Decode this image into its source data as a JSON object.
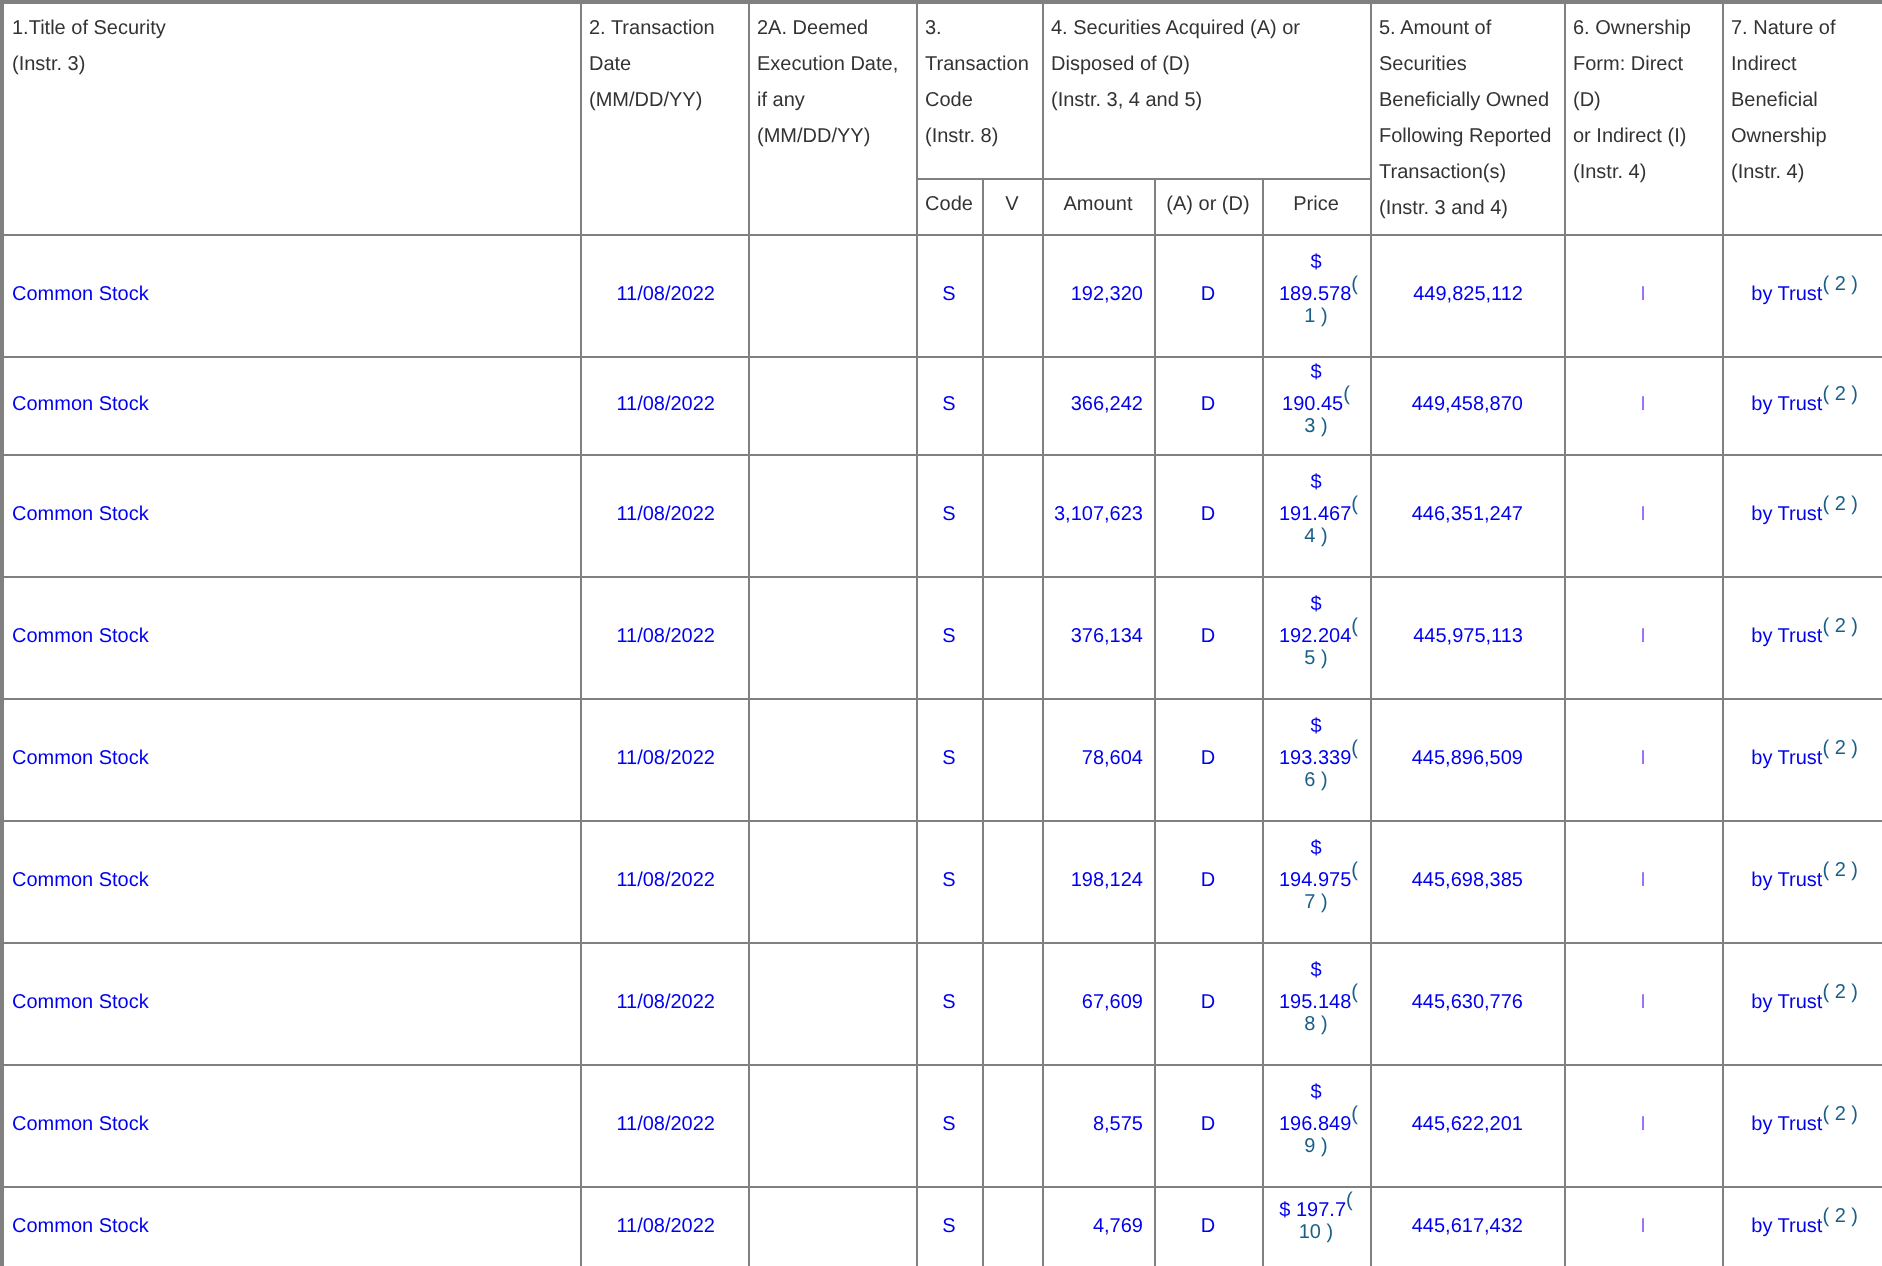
{
  "header": {
    "title_of_security": [
      "1.Title of Security",
      "(Instr. 3)"
    ],
    "transaction_date": [
      "2. Transaction",
      "Date",
      "(MM/DD/YY)"
    ],
    "deemed_execution_date": [
      "2A. Deemed",
      "Execution Date,",
      "if any",
      "(MM/DD/YY)"
    ],
    "transaction_code": [
      "3.",
      "Transaction",
      "Code",
      "(Instr. 8)"
    ],
    "securities_acquired_disposed": [
      "4. Securities Acquired (A) or",
      "Disposed of (D)",
      "(Instr. 3, 4 and 5)"
    ],
    "amount_owned": [
      "5. Amount of",
      "Securities",
      "Beneficially Owned",
      "Following Reported",
      "Transaction(s)",
      "(Instr. 3 and 4)"
    ],
    "ownership_form": [
      "6. Ownership",
      "Form: Direct (D)",
      "or Indirect (I)",
      "(Instr. 4)"
    ],
    "nature_of_ownership": [
      "7. Nature of",
      "Indirect",
      "Beneficial",
      "Ownership",
      "(Instr. 4)"
    ],
    "subheaders": [
      "Code",
      "V",
      "Amount",
      "(A) or (D)",
      "Price"
    ]
  },
  "rows": [
    {
      "title": "Common Stock",
      "date": "11/08/2022",
      "code": "S",
      "amount": "192,320",
      "a_or_d": "D",
      "price": "$ 189.578",
      "price_note": "( 1 )",
      "owned": "449,825,112",
      "form": "I",
      "nature": "by Trust",
      "nature_note": "( 2 )"
    },
    {
      "title": "Common Stock",
      "date": "11/08/2022",
      "code": "S",
      "amount": "366,242",
      "a_or_d": "D",
      "price": "$ 190.45",
      "price_note": "( 3 )",
      "owned": "449,458,870",
      "form": "I",
      "nature": "by Trust",
      "nature_note": "( 2 )"
    },
    {
      "title": "Common Stock",
      "date": "11/08/2022",
      "code": "S",
      "amount": "3,107,623",
      "a_or_d": "D",
      "price": "$ 191.467",
      "price_note": "( 4 )",
      "owned": "446,351,247",
      "form": "I",
      "nature": "by Trust",
      "nature_note": "( 2 )"
    },
    {
      "title": "Common Stock",
      "date": "11/08/2022",
      "code": "S",
      "amount": "376,134",
      "a_or_d": "D",
      "price": "$ 192.204",
      "price_note": "( 5 )",
      "owned": "445,975,113",
      "form": "I",
      "nature": "by Trust",
      "nature_note": "( 2 )"
    },
    {
      "title": "Common Stock",
      "date": "11/08/2022",
      "code": "S",
      "amount": "78,604",
      "a_or_d": "D",
      "price": "$ 193.339",
      "price_note": "( 6 )",
      "owned": "445,896,509",
      "form": "I",
      "nature": "by Trust",
      "nature_note": "( 2 )"
    },
    {
      "title": "Common Stock",
      "date": "11/08/2022",
      "code": "S",
      "amount": "198,124",
      "a_or_d": "D",
      "price": "$ 194.975",
      "price_note": "( 7 )",
      "owned": "445,698,385",
      "form": "I",
      "nature": "by Trust",
      "nature_note": "( 2 )"
    },
    {
      "title": "Common Stock",
      "date": "11/08/2022",
      "code": "S",
      "amount": "67,609",
      "a_or_d": "D",
      "price": "$ 195.148",
      "price_note": "( 8 )",
      "owned": "445,630,776",
      "form": "I",
      "nature": "by Trust",
      "nature_note": "( 2 )"
    },
    {
      "title": "Common Stock",
      "date": "11/08/2022",
      "code": "S",
      "amount": "8,575",
      "a_or_d": "D",
      "price": "$ 196.849",
      "price_note": "( 9 )",
      "owned": "445,622,201",
      "form": "I",
      "nature": "by Trust",
      "nature_note": "( 2 )"
    },
    {
      "title": "Common Stock",
      "date": "11/08/2022",
      "code": "S",
      "amount": "4,769",
      "a_or_d": "D",
      "price": "$ 197.7",
      "price_note": "( 10 )",
      "owned": "445,617,432",
      "form": "I",
      "nature": "by Trust",
      "nature_note": "( 2 )"
    }
  ]
}
